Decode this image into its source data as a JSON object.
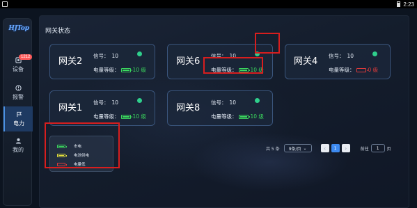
{
  "statusbar": {
    "time": "2:23"
  },
  "sidebar": {
    "logo": "HJTop",
    "items": [
      {
        "label": "设备",
        "icon": "device-icon",
        "badge": "1212",
        "active": false
      },
      {
        "label": "报警",
        "icon": "alarm-icon",
        "active": false
      },
      {
        "label": "电力",
        "icon": "power-icon",
        "active": true
      },
      {
        "label": "我的",
        "icon": "user-icon",
        "active": false
      }
    ]
  },
  "main": {
    "title": "网关状态",
    "signal_label": "信号：",
    "power_label": "电量等级：",
    "gateways": [
      {
        "name": "网关2",
        "signal": "10",
        "level": "10 级",
        "battery": "full",
        "status_color": "#2fcf8c"
      },
      {
        "name": "网关6",
        "signal": "10",
        "level": "10 级",
        "battery": "full",
        "status_color": "#2fcf8c"
      },
      {
        "name": "网关4",
        "signal": "10",
        "level": "0 级",
        "battery": "low",
        "status_color": "#2fcf8c"
      },
      {
        "name": "网关1",
        "signal": "10",
        "level": "10 级",
        "battery": "full",
        "status_color": "#2fcf8c"
      },
      {
        "name": "网关8",
        "signal": "10",
        "level": "10 级",
        "battery": "full",
        "status_color": "#2fcf8c"
      }
    ],
    "legend": [
      {
        "label": "市电",
        "battery": "full"
      },
      {
        "label": "电池供电",
        "battery": "mid"
      },
      {
        "label": "电量低",
        "battery": "low"
      }
    ],
    "pagination": {
      "total": "共 5 条",
      "page_size": "9条/页",
      "current_page": "1",
      "goto_prefix": "前往",
      "goto_value": "1",
      "goto_suffix": "页"
    }
  },
  "colors": {
    "accent": "#3d8af0",
    "ok": "#3bd95e",
    "low": "#e03b3b",
    "mid": "#e6e23c",
    "annotation": "#d81e1e"
  }
}
